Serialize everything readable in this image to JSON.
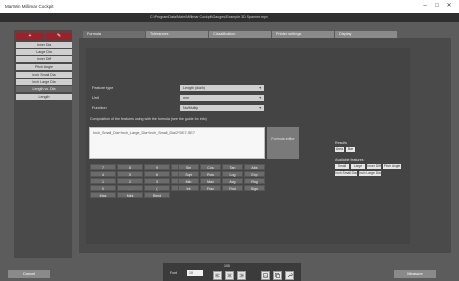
{
  "window": {
    "title": "MarWin Millimar Cockpit",
    "file_path": "C:\\ProgramData\\Mahr\\Millimar Cockpit\\Gauges\\Example 3D Spanner.mpx",
    "minimize_glyph": "–",
    "maximize_glyph": "□",
    "close_glyph": "✕"
  },
  "left_panel": {
    "add_label": "+",
    "edit_label": "✎",
    "items": [
      {
        "label": "Inner Dia"
      },
      {
        "label": "Large Dia"
      },
      {
        "label": "Inner Diff"
      },
      {
        "label": "Pitch Angle"
      },
      {
        "label": "Inch Small Dia"
      },
      {
        "label": "Inch Large Dia"
      },
      {
        "label": "Length vs. Dia"
      },
      {
        "label": "Length"
      }
    ]
  },
  "tabs": [
    {
      "label": "Formula"
    },
    {
      "label": "Tolerances"
    },
    {
      "label": "Classification"
    },
    {
      "label": "Printer settings"
    },
    {
      "label": "Display"
    }
  ],
  "form": {
    "feature_type_label": "Feature type",
    "feature_type_value": "Length (dia/h)",
    "unit_label": "Unit",
    "unit_value": "mm",
    "function_label": "Function",
    "function_value": "No/Multip",
    "hint_text": "Composition of the features using with the formula (see the guide for info)",
    "expression": "Inch_Small_Dia+Inch_Large_Dia+Inch_Small_Dia/2*DE7-SE7"
  },
  "formula_button_label": "Formula editor",
  "keypad_left": [
    [
      "7",
      "8",
      "9",
      "/"
    ],
    [
      "4",
      "5",
      "6",
      "*"
    ],
    [
      "1",
      "2",
      "3",
      "-"
    ],
    [
      "0",
      ".",
      "(",
      ")"
    ],
    [
      "Max",
      "Mini",
      "Rend"
    ]
  ],
  "keypad_right": [
    [
      "Sin",
      "Cos",
      "Tan",
      "Abs"
    ],
    [
      "Sqrt",
      "Pow",
      "Log",
      "Exp"
    ],
    [
      "Min",
      "Max",
      "Avg",
      "Rng"
    ],
    [
      "Int",
      "Frac",
      "Rnd",
      "Sign"
    ]
  ],
  "right": {
    "matrix_label": "Results",
    "matrix_chips": [
      "Area",
      "Bar"
    ],
    "avail_label": "Available features",
    "chips_row1": [
      "Small Dia",
      "Large Dia",
      "Inner Diff",
      "Pitch Angle"
    ],
    "chips_row2": [
      "Inch Small Dia",
      "Inch Large Dia"
    ]
  },
  "bottom": {
    "cancel_label": "Cancel",
    "measure_label": "Measure",
    "zoom_value": "100",
    "font_label": "Font",
    "font_value": "10",
    "icons": [
      "align-left-icon",
      "align-center-icon",
      "align-right-icon",
      "image-icon",
      "copy-icon",
      "wrench-icon"
    ]
  },
  "colors": {
    "accent_red": "#a0202a",
    "panel_dark": "#4a4a4a",
    "background": "#5c5c5c"
  }
}
